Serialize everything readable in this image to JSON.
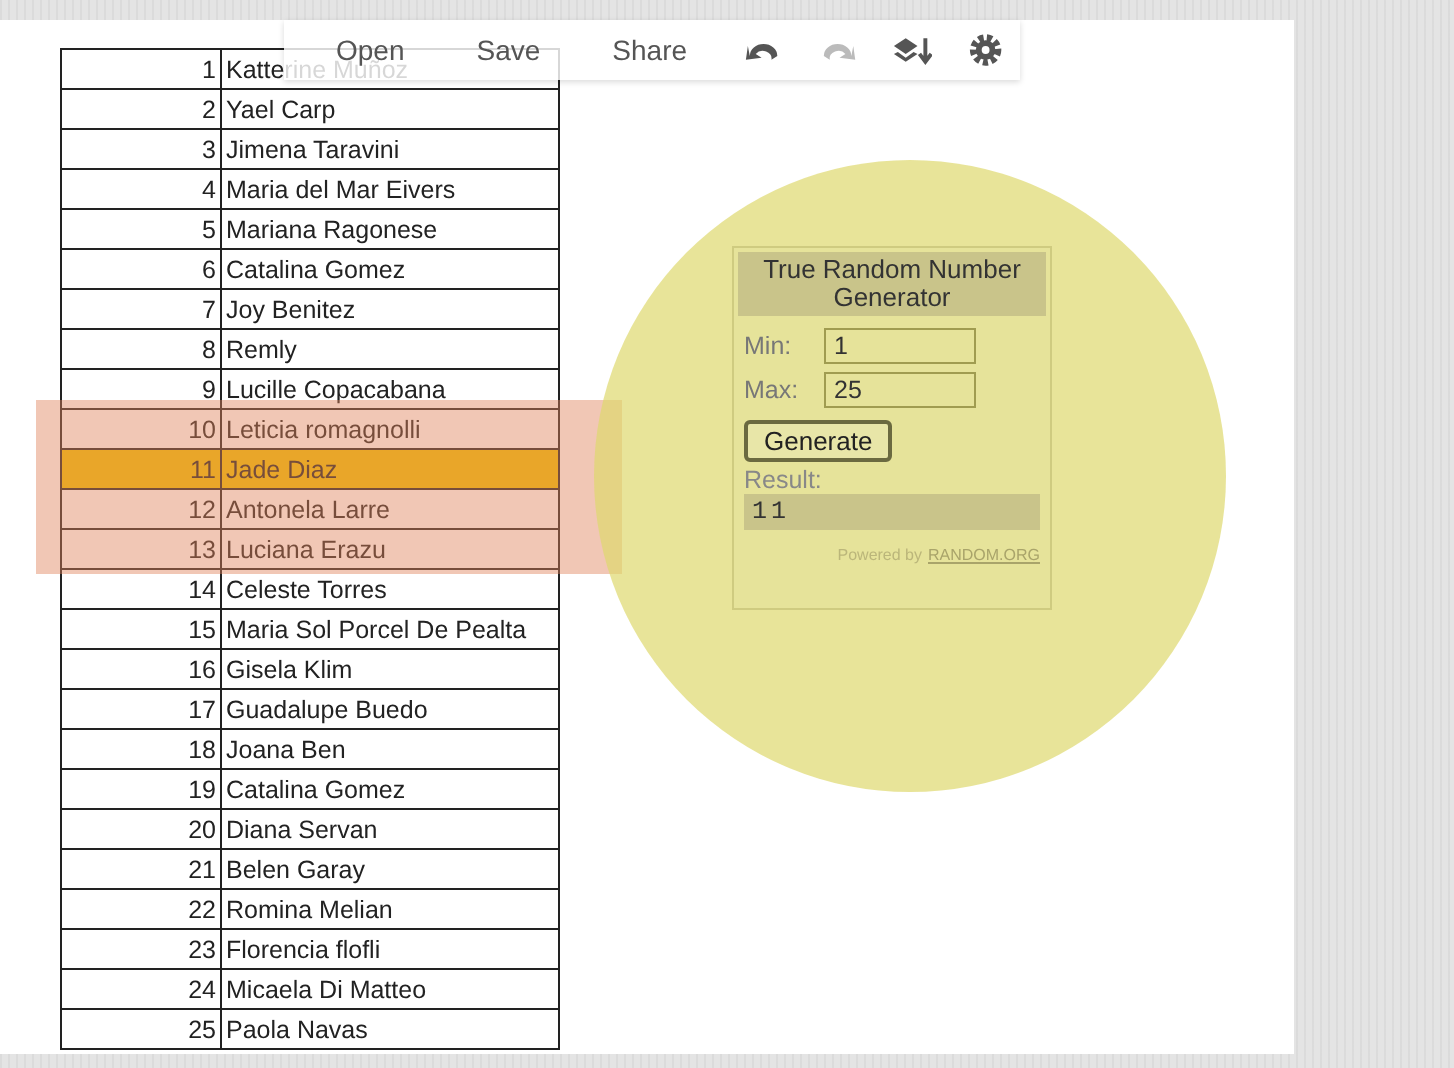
{
  "toolbar": {
    "buttons": [
      {
        "label": "Open"
      },
      {
        "label": "Save"
      },
      {
        "label": "Share"
      }
    ],
    "tools": [
      {
        "kind": "undo",
        "disabled": false
      },
      {
        "kind": "redo",
        "disabled": true
      },
      {
        "kind": "layers",
        "disabled": false
      },
      {
        "kind": "settings",
        "disabled": false
      }
    ]
  },
  "table": {
    "rows": [
      {
        "number": "1",
        "name": "Katterine Muñoz",
        "selected": false
      },
      {
        "number": "2",
        "name": "Yael Carp",
        "selected": false
      },
      {
        "number": "3",
        "name": "Jimena Taravini",
        "selected": false
      },
      {
        "number": "4",
        "name": "Maria del Mar Eivers",
        "selected": false
      },
      {
        "number": "5",
        "name": "Mariana Ragonese",
        "selected": false
      },
      {
        "number": "6",
        "name": "Catalina Gomez",
        "selected": false
      },
      {
        "number": "7",
        "name": "Joy Benitez",
        "selected": false
      },
      {
        "number": "8",
        "name": "Remly",
        "selected": false
      },
      {
        "number": "9",
        "name": "Lucille Copacabana",
        "selected": false
      },
      {
        "number": "10",
        "name": "Leticia romagnolli",
        "selected": false
      },
      {
        "number": "11",
        "name": "Jade Diaz",
        "selected": true
      },
      {
        "number": "12",
        "name": "Antonela Larre",
        "selected": false
      },
      {
        "number": "13",
        "name": "Luciana Erazu",
        "selected": false
      },
      {
        "number": "14",
        "name": "Celeste Torres",
        "selected": false
      },
      {
        "number": "15",
        "name": "Maria Sol Porcel De Pealta",
        "selected": false
      },
      {
        "number": "16",
        "name": "Gisela Klim",
        "selected": false
      },
      {
        "number": "17",
        "name": "Guadalupe Buedo",
        "selected": false
      },
      {
        "number": "18",
        "name": "Joana Ben",
        "selected": false
      },
      {
        "number": "19",
        "name": "Catalina Gomez",
        "selected": false
      },
      {
        "number": "20",
        "name": "Diana Servan",
        "selected": false
      },
      {
        "number": "21",
        "name": "Belen Garay",
        "selected": false
      },
      {
        "number": "22",
        "name": "Romina Melian",
        "selected": false
      },
      {
        "number": "23",
        "name": "Florencia flofli",
        "selected": false
      },
      {
        "number": "24",
        "name": "Micaela Di Matteo",
        "selected": false
      },
      {
        "number": "25",
        "name": "Paola Navas",
        "selected": false
      }
    ]
  },
  "generator": {
    "title": "True Random Number Generator",
    "min_label": "Min:",
    "min_value": "1",
    "max_label": "Max:",
    "max_value": "25",
    "button": "Generate",
    "result_label": "Result:",
    "result": "11",
    "powered_by": "Powered by",
    "link": "RANDOM.ORG"
  }
}
